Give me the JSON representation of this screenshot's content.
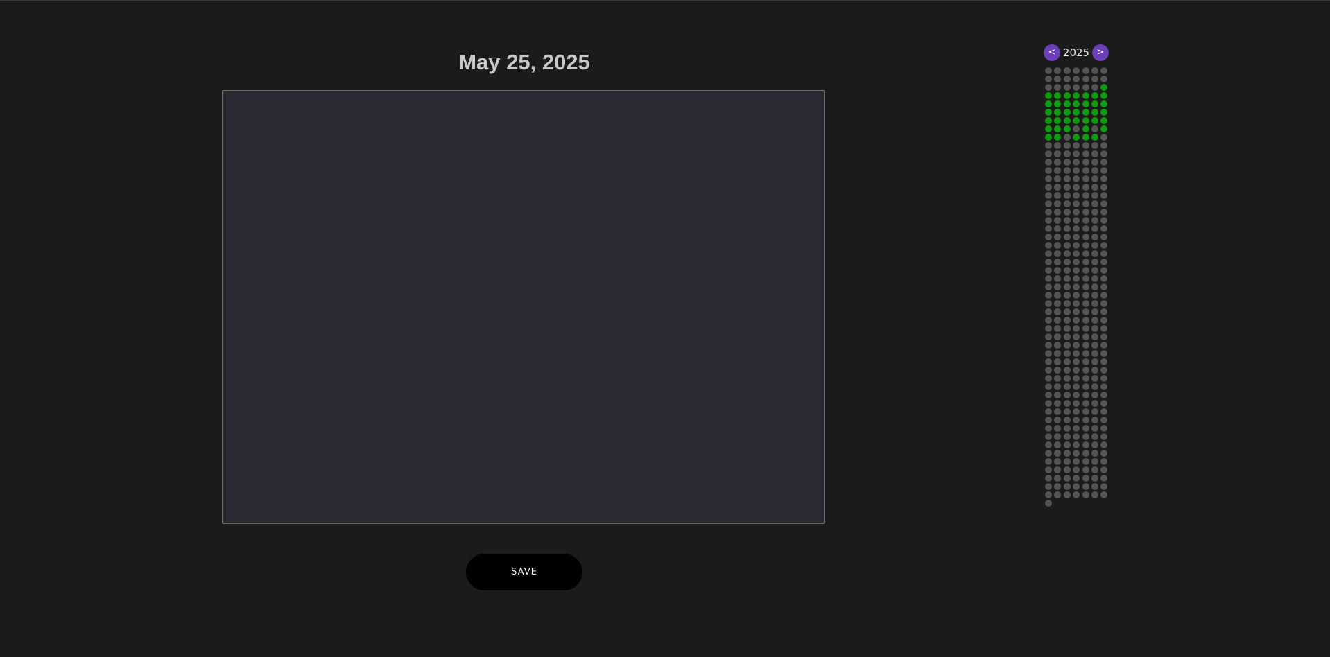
{
  "page": {
    "date_title": "May 25, 2025"
  },
  "editor": {
    "value": "",
    "placeholder": ""
  },
  "actions": {
    "save_label": "SAVE"
  },
  "calendar": {
    "year": "2025",
    "prev_label": "<",
    "next_label": ">",
    "columns": 7,
    "total_days": 365,
    "entry_days": [
      20,
      21,
      22,
      23,
      24,
      25,
      26,
      27,
      28,
      29,
      30,
      31,
      32,
      33,
      34,
      35,
      36,
      37,
      38,
      39,
      40,
      41,
      42,
      43,
      44,
      45,
      46,
      47,
      48,
      49,
      50,
      51,
      53,
      55,
      56,
      57,
      59,
      60,
      61
    ],
    "colors": {
      "empty": "#545454",
      "entry": "#0e9a0e",
      "nav_button": "#6b3fb8"
    }
  }
}
